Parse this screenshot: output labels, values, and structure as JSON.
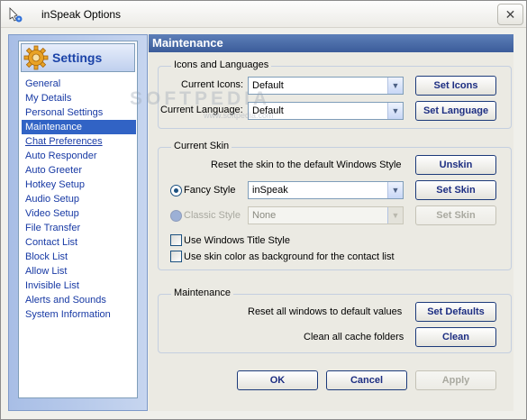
{
  "window": {
    "title": "inSpeak Options",
    "close_symbol": "✕"
  },
  "sidebar": {
    "header": "Settings",
    "items": [
      {
        "label": "General"
      },
      {
        "label": "My Details"
      },
      {
        "label": "Personal Settings"
      },
      {
        "label": "Maintenance",
        "selected": true
      },
      {
        "label": "Chat Preferences"
      },
      {
        "label": "Auto Responder"
      },
      {
        "label": "Auto Greeter"
      },
      {
        "label": "Hotkey Setup"
      },
      {
        "label": "Audio Setup"
      },
      {
        "label": "Video Setup"
      },
      {
        "label": "File Transfer"
      },
      {
        "label": "Contact List"
      },
      {
        "label": "Block List"
      },
      {
        "label": "Allow List"
      },
      {
        "label": "Invisible List"
      },
      {
        "label": "Alerts and Sounds"
      },
      {
        "label": "System Information"
      }
    ]
  },
  "main": {
    "header": "Maintenance",
    "icons_languages": {
      "title": "Icons and Languages",
      "icons_label": "Current Icons:",
      "icons_value": "Default",
      "icons_button": "Set Icons",
      "language_label": "Current Language:",
      "language_value": "Default",
      "language_button": "Set Language"
    },
    "skin": {
      "title": "Current Skin",
      "reset_text": "Reset the skin to the default Windows Style",
      "unskin_button": "Unskin",
      "fancy_label": "Fancy Style",
      "fancy_value": "inSpeak",
      "fancy_button": "Set Skin",
      "classic_label": "Classic Style",
      "classic_value": "None",
      "classic_button": "Set Skin",
      "title_style_label": "Use Windows Title Style",
      "skin_color_label": "Use skin color as background for the contact list"
    },
    "maintenance": {
      "title": "Maintenance",
      "reset_text": "Reset all windows to default values",
      "defaults_button": "Set Defaults",
      "cache_text": "Clean all cache folders",
      "clean_button": "Clean"
    },
    "footer": {
      "ok": "OK",
      "cancel": "Cancel",
      "apply": "Apply"
    }
  },
  "watermark": {
    "main": "SOFTPEDIA",
    "sub": "www.softpedia.com"
  }
}
